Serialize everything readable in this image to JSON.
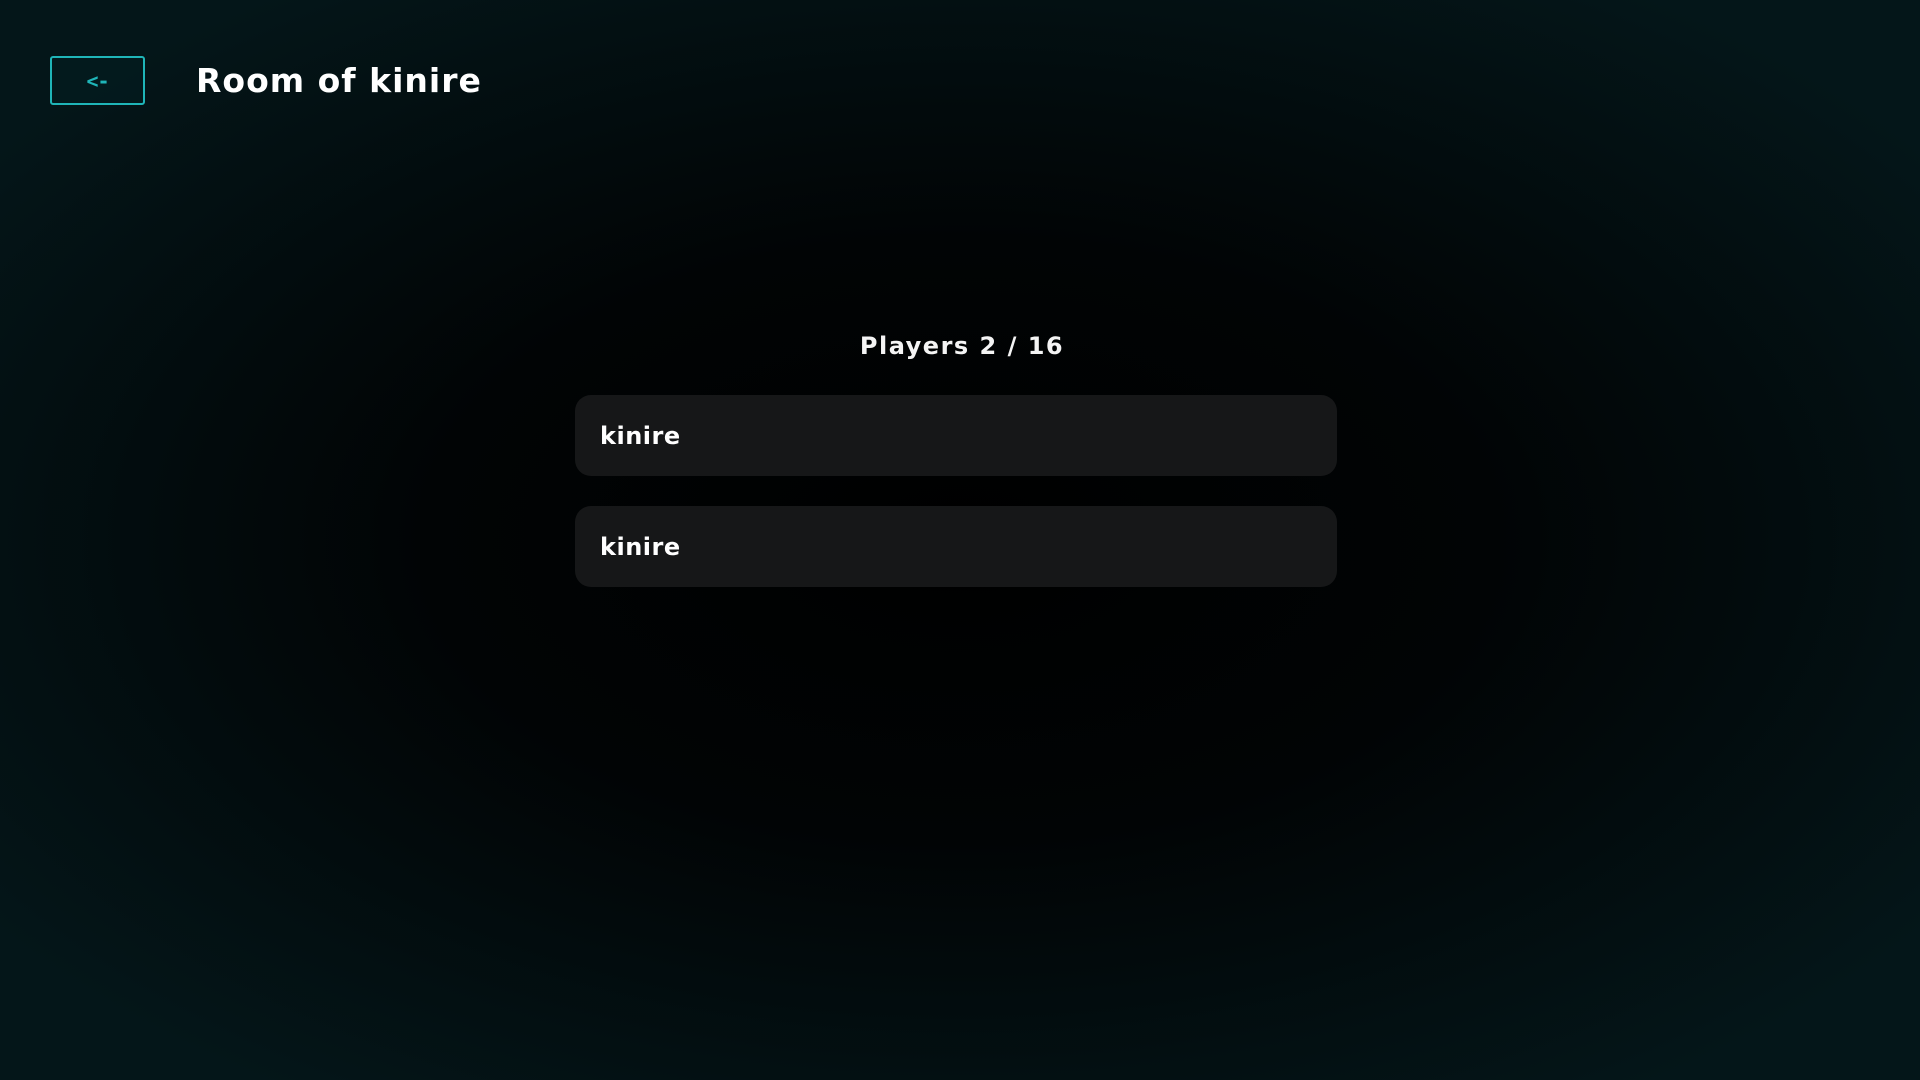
{
  "colors": {
    "accent": "#1fb5b8",
    "background_center": "#000000",
    "background_edge": "#041619",
    "card": "#161718",
    "text": "#ffffff"
  },
  "header": {
    "back_button": {
      "icon": "arrow-left-icon",
      "label": "<-"
    },
    "title": "Room of kinire"
  },
  "players": {
    "count_label": "Players 2 / 16",
    "items": [
      {
        "name": "kinire"
      },
      {
        "name": "kinire"
      }
    ]
  }
}
